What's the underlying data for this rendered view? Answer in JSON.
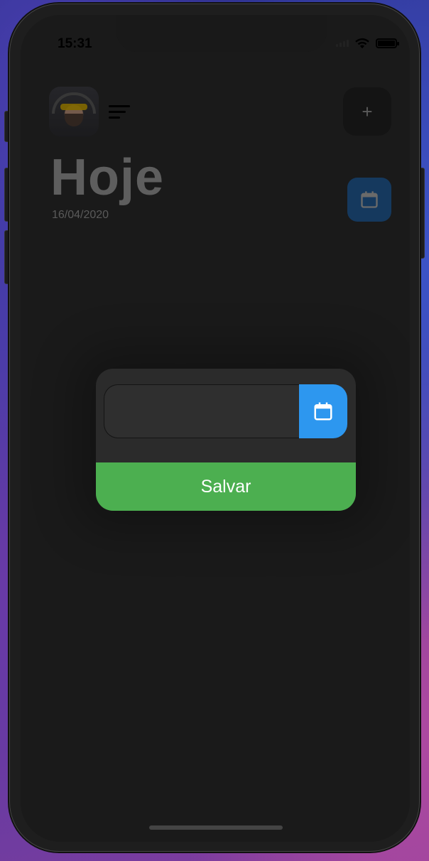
{
  "status_bar": {
    "time": "15:31"
  },
  "header": {
    "add_label": "+",
    "title": "Hoje",
    "date": "16/04/2020"
  },
  "dialog": {
    "date_value": "",
    "save_label": "Salvar"
  },
  "colors": {
    "accent_blue": "#2d97ef",
    "save_green": "#4caf50",
    "background": "#1a1a1a"
  },
  "icons": {
    "menu": "sort-icon",
    "add": "plus-icon",
    "calendar": "calendar-icon"
  }
}
